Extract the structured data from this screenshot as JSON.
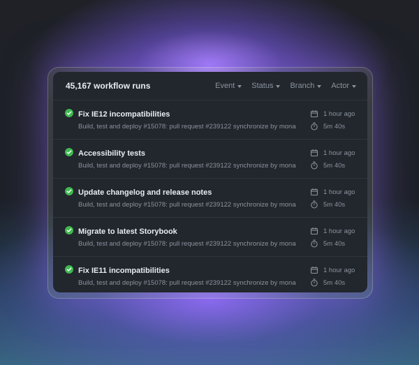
{
  "header": {
    "run_count": "45,167 workflow runs",
    "filters": [
      {
        "label": "Event"
      },
      {
        "label": "Status"
      },
      {
        "label": "Branch"
      },
      {
        "label": "Actor"
      }
    ]
  },
  "runs": [
    {
      "title": "Fix IE12 incompatibilities",
      "subtitle": "Build, test and deploy #15078: pull request #239122 synchronize by mona",
      "time": "1 hour ago",
      "duration": "5m 40s",
      "status": "success"
    },
    {
      "title": "Accessibility tests",
      "subtitle": "Build, test and deploy #15078: pull request #239122 synchronize by mona",
      "time": "1 hour ago",
      "duration": "5m 40s",
      "status": "success"
    },
    {
      "title": "Update changelog and release notes",
      "subtitle": "Build, test and deploy #15078: pull request #239122 synchronize by mona",
      "time": "1 hour ago",
      "duration": "5m 40s",
      "status": "success"
    },
    {
      "title": "Migrate to latest Storybook",
      "subtitle": "Build, test and deploy #15078: pull request #239122 synchronize by mona",
      "time": "1 hour ago",
      "duration": "5m 40s",
      "status": "success"
    },
    {
      "title": "Fix IE11 incompatibilities",
      "subtitle": "Build, test and deploy #15078: pull request #239122 synchronize by mona",
      "time": "1 hour ago",
      "duration": "5m 40s",
      "status": "success"
    }
  ],
  "icons": {
    "status": "check-circle-icon",
    "time": "calendar-icon",
    "duration": "stopwatch-icon",
    "filter": "caret-down-icon"
  },
  "colors": {
    "success": "#3fb950",
    "panel": "#22262d",
    "text_primary": "#e6edf3",
    "text_muted": "#8b949e"
  }
}
